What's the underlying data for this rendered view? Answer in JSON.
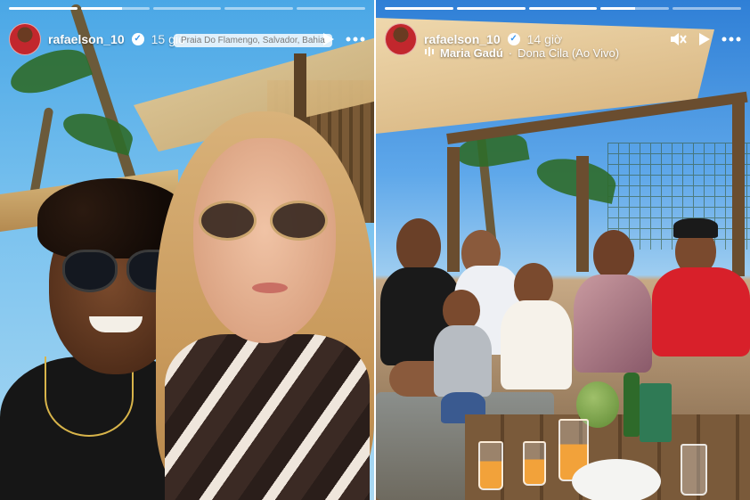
{
  "stories": [
    {
      "username": "rafaelson_10",
      "time": "15 giờ",
      "location": "Praia Do Flamengo, Salvador, Bahia",
      "progress": [
        1,
        0.6,
        0,
        0,
        0
      ]
    },
    {
      "username": "rafaelson_10",
      "time": "14 giờ",
      "music": {
        "artist": "Maria Gadú",
        "separator": "·",
        "track": "Dona Cila (Ao Vivo)"
      },
      "progress": [
        1,
        1,
        1,
        0.5,
        0
      ]
    }
  ],
  "icons": {
    "verified": "verified-badge-icon",
    "play": "play-icon",
    "more": "more-options-icon",
    "mute": "mute-icon",
    "music": "music-note-icon"
  },
  "colors": {
    "verified_blue": "#3897f0",
    "progress_fill": "#ffffff",
    "jersey_red": "#d8202a"
  }
}
